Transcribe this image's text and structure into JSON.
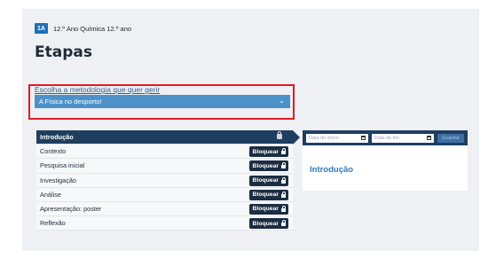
{
  "header": {
    "badge": "1A",
    "course": "12.º Ano Química 12.º ano"
  },
  "page_title": "Etapas",
  "methodology": {
    "prompt": "Escolha a metodologia que quer gerir",
    "selected": "A Física no desporto!"
  },
  "stages": [
    {
      "label": "Introdução",
      "active": true
    },
    {
      "label": "Contexto",
      "button": "Bloquear"
    },
    {
      "label": "Pesquisa inicial",
      "button": "Bloquear"
    },
    {
      "label": "Investigação",
      "button": "Bloquear"
    },
    {
      "label": "Análise",
      "button": "Bloquear"
    },
    {
      "label": "Apresentação: poster",
      "button": "Bloquear"
    },
    {
      "label": "Reflexão",
      "button": "Bloquear"
    }
  ],
  "detail": {
    "start_placeholder": "Data de início",
    "end_placeholder": "Data de fim",
    "save_label": "Guardar",
    "title": "Introdução"
  },
  "colors": {
    "accent": "#1e3e5f",
    "select": "#4c92c9",
    "highlight": "#e01b24"
  }
}
